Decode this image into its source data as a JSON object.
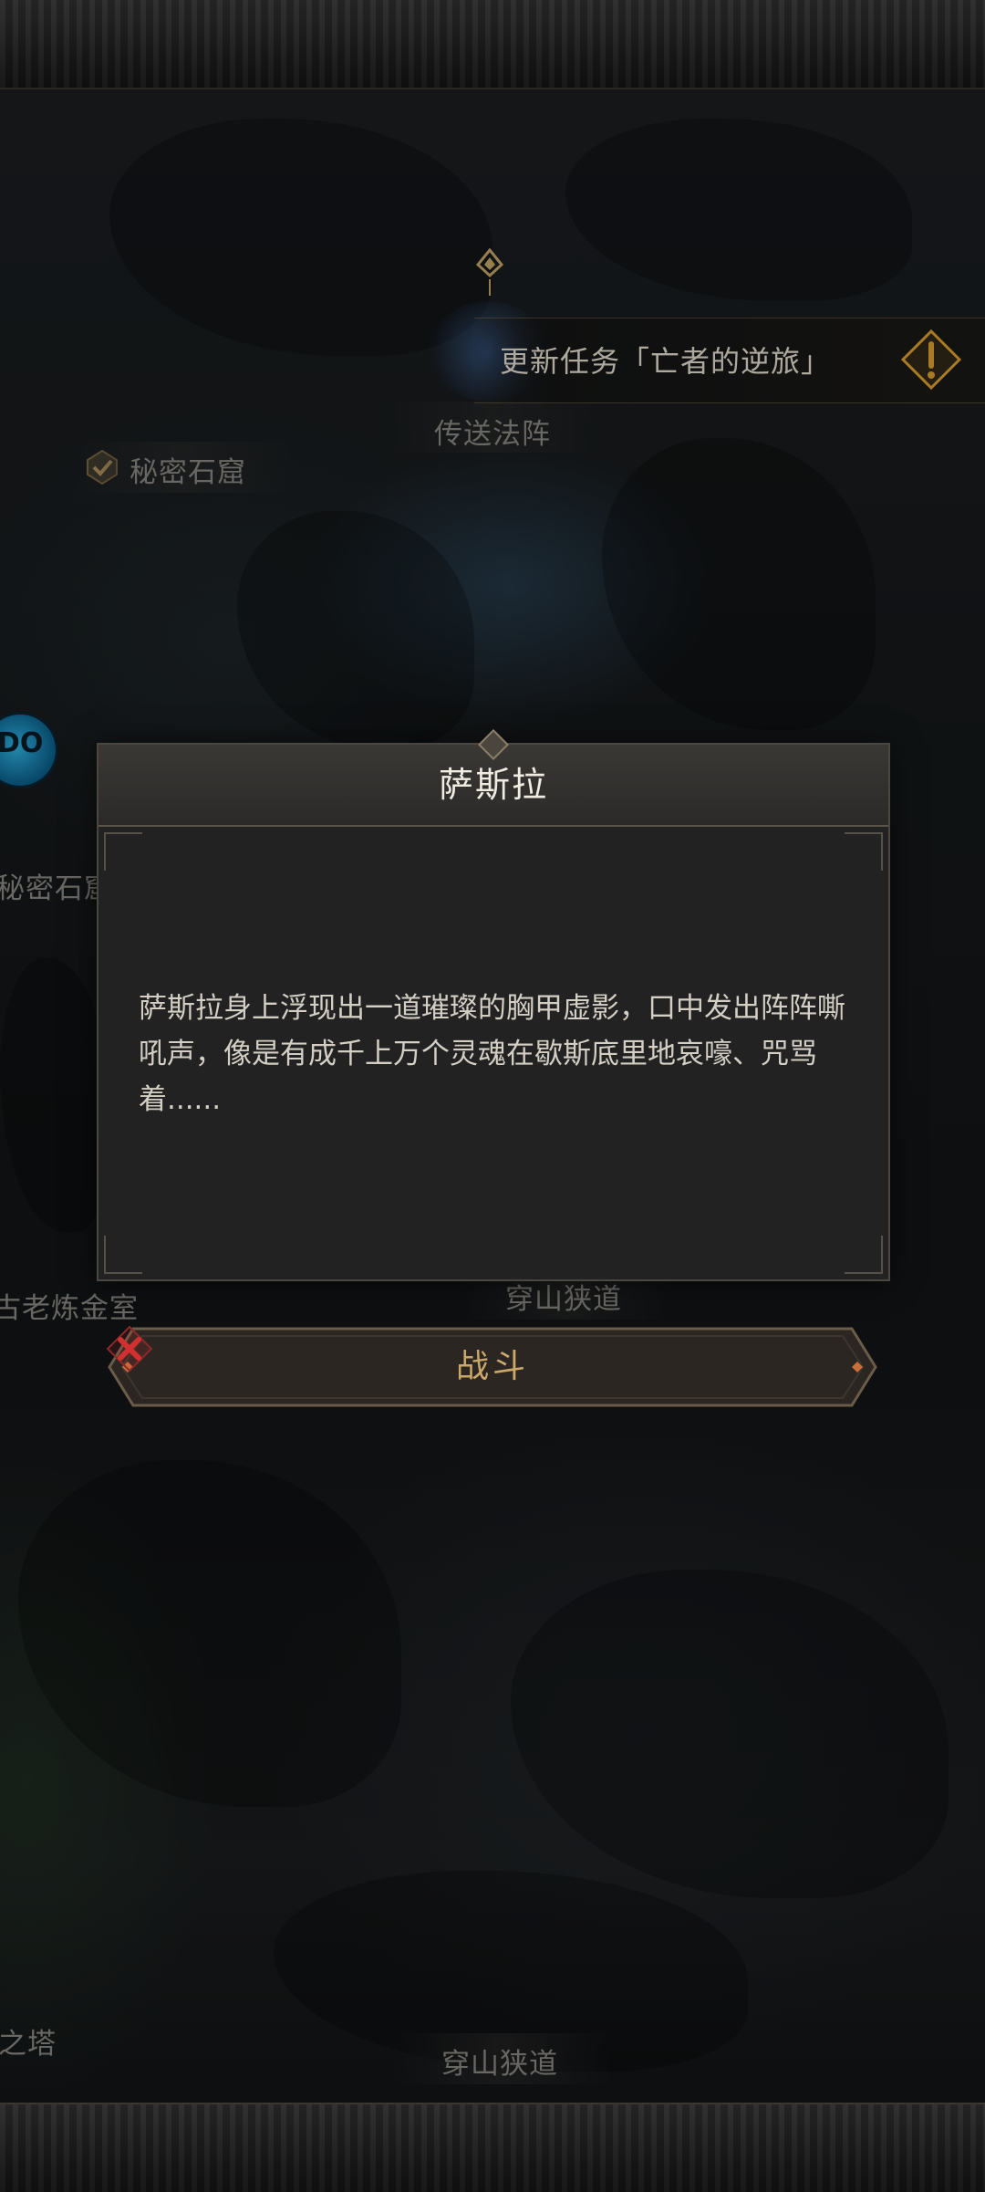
{
  "map": {
    "labels": {
      "secret_cave_1": "秘密石窟",
      "teleport_array": "传送法阵",
      "secret_cave_2": "秘密石窟",
      "ancient_alchemy": "古老炼金室",
      "mountain_pass_1": "穿山狭道",
      "tower": "之塔",
      "mountain_pass_2": "穿山狭道"
    },
    "avatar_text": "DO\nMAY"
  },
  "quest": {
    "text": "更新任务「亡者的逆旅」"
  },
  "dialog": {
    "title": "萨斯拉",
    "body": "萨斯拉身上浮现出一道璀璨的胸甲虚影，口中发出阵阵嘶吼声，像是有成千上万个灵魂在歇斯底里地哀嚎、咒骂着......"
  },
  "fight_button": {
    "label": "战斗"
  },
  "colors": {
    "accent_gold": "#c9a86a",
    "quest_icon": "#e0a530",
    "cancel_red": "#d03030"
  }
}
